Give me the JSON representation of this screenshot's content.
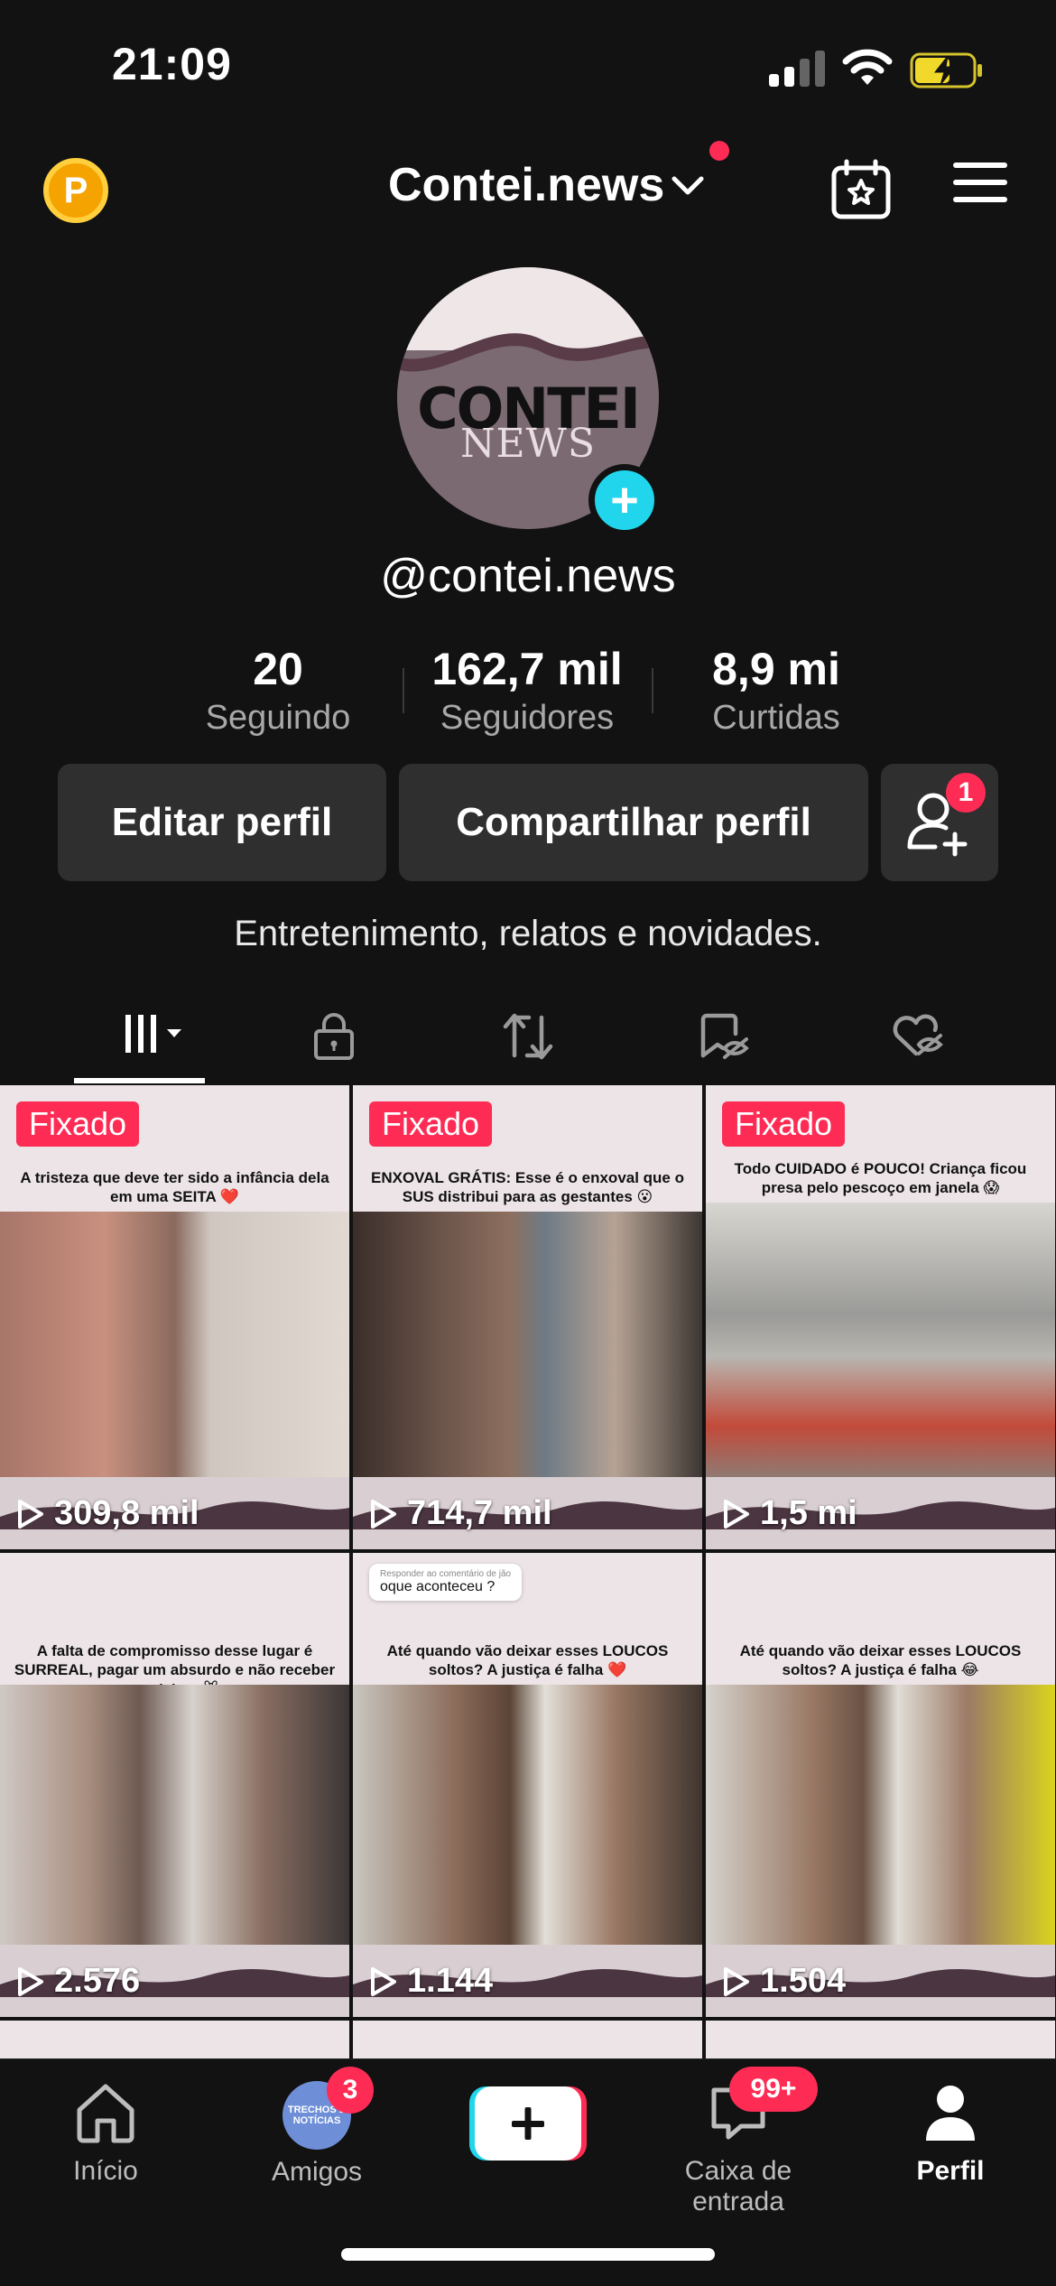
{
  "status_bar": {
    "time": "21:09"
  },
  "header": {
    "account_name": "Contei.news"
  },
  "profile": {
    "avatar_logo": "CONTEI",
    "avatar_logo_sub": "NEWS",
    "username": "@contei.news",
    "bio": "Entretenimento, relatos e novidades."
  },
  "stats": [
    {
      "value": "20",
      "label": "Seguindo"
    },
    {
      "value": "162,7 mil",
      "label": "Seguidores"
    },
    {
      "value": "8,9 mi",
      "label": "Curtidas"
    }
  ],
  "buttons": {
    "edit": "Editar perfil",
    "share": "Compartilhar perfil",
    "friend_badge": "1"
  },
  "tabs": [
    "videos-icon",
    "lock-icon",
    "repost-icon",
    "favorites-hidden-icon",
    "liked-hidden-icon"
  ],
  "videos": [
    {
      "pinned": "Fixado",
      "caption": "A tristeza que deve ter sido a infância dela em uma SEITA ❤️",
      "views": "309,8 mil"
    },
    {
      "pinned": "Fixado",
      "caption": "ENXOVAL GRÁTIS: Esse é o enxoval que o SUS distribui para as gestantes 😮",
      "views": "714,7 mil"
    },
    {
      "pinned": "Fixado",
      "caption": "Todo CUIDADO é POUCO! Criança ficou presa pelo pescoço em janela 😱",
      "views": "1,5 mi"
    },
    {
      "caption": "A falta de compromisso desse lugar é SURREAL, pagar um absurdo e não receber o mínimo 🐭",
      "views": "2.576"
    },
    {
      "comment_label": "Responder ao comentário de jão",
      "comment": "oque aconteceu ?",
      "caption": "Até quando vão deixar esses LOUCOS soltos? A justiça é falha ❤️",
      "views": "1.144"
    },
    {
      "caption": "Até quando vão deixar esses LOUCOS soltos? A justiça é falha 😂",
      "views": "1.504"
    }
  ],
  "bottom_nav": {
    "home": "Início",
    "friends": "Amigos",
    "friends_badge": "3",
    "friends_avatar_text": "TRECHOS E NOTÍCIAS",
    "inbox": "Caixa de entrada",
    "inbox_badge": "99+",
    "profile": "Perfil"
  },
  "colors": {
    "accent_red": "#fe2c55",
    "accent_cyan": "#20d5ec",
    "background": "#121212"
  }
}
